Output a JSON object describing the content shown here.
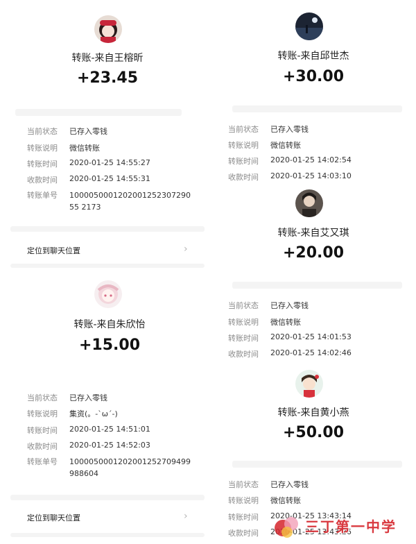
{
  "left": {
    "card1": {
      "avatar_icon": "avatar-girl-red-icon",
      "title": "转账-来自王榕昕",
      "amount": "+23.45",
      "rows": [
        {
          "label": "当前状态",
          "value": "已存入零钱"
        },
        {
          "label": "转账说明",
          "value": "微信转账"
        },
        {
          "label": "转账时间",
          "value": "2020-01-25 14:55:27"
        },
        {
          "label": "收款时间",
          "value": "2020-01-25 14:55:31"
        },
        {
          "label": "转账单号",
          "value": "100005000120200125230729055 2173"
        }
      ],
      "locate": "定位到聊天位置"
    },
    "card2": {
      "avatar_icon": "avatar-anime-girl-icon",
      "title": "转账-来自朱欣怡",
      "amount": "+15.00",
      "rows": [
        {
          "label": "当前状态",
          "value": "已存入零钱"
        },
        {
          "label": "转账说明",
          "value": "集资(。-`ω´-)"
        },
        {
          "label": "转账时间",
          "value": "2020-01-25 14:51:01"
        },
        {
          "label": "收款时间",
          "value": "2020-01-25 14:52:03"
        },
        {
          "label": "转账单号",
          "value": "1000050001202001252709499988604"
        }
      ],
      "locate": "定位到聊天位置"
    }
  },
  "right": {
    "card1": {
      "avatar_icon": "avatar-night-scene-icon",
      "title": "转账-来自邱世杰",
      "amount": "+30.00",
      "rows": [
        {
          "label": "当前状态",
          "value": "已存入零钱"
        },
        {
          "label": "转账说明",
          "value": "微信转账"
        },
        {
          "label": "转账时间",
          "value": "2020-01-25 14:02:54"
        },
        {
          "label": "收款时间",
          "value": "2020-01-25 14:03:10"
        }
      ]
    },
    "card2": {
      "avatar_icon": "avatar-person-dark-icon",
      "title": "转账-来自艾又琪",
      "amount": "+20.00",
      "rows": [
        {
          "label": "当前状态",
          "value": "已存入零钱"
        },
        {
          "label": "转账说明",
          "value": "微信转账"
        },
        {
          "label": "转账时间",
          "value": "2020-01-25 14:01:53"
        },
        {
          "label": "收款时间",
          "value": "2020-01-25 14:02:46"
        }
      ]
    },
    "card3": {
      "avatar_icon": "avatar-cartoon-girl-icon",
      "title": "转账-来自黄小燕",
      "amount": "+50.00",
      "rows": [
        {
          "label": "当前状态",
          "value": "已存入零钱"
        },
        {
          "label": "转账说明",
          "value": "微信转账"
        },
        {
          "label": "转账时间",
          "value": "2020-01-25 13:43:14"
        },
        {
          "label": "收款时间",
          "value": "2020-01-25 13:43:26"
        }
      ]
    }
  },
  "watermark": {
    "text": "三丁第一中学",
    "icon": "watermark-logo-icon"
  }
}
